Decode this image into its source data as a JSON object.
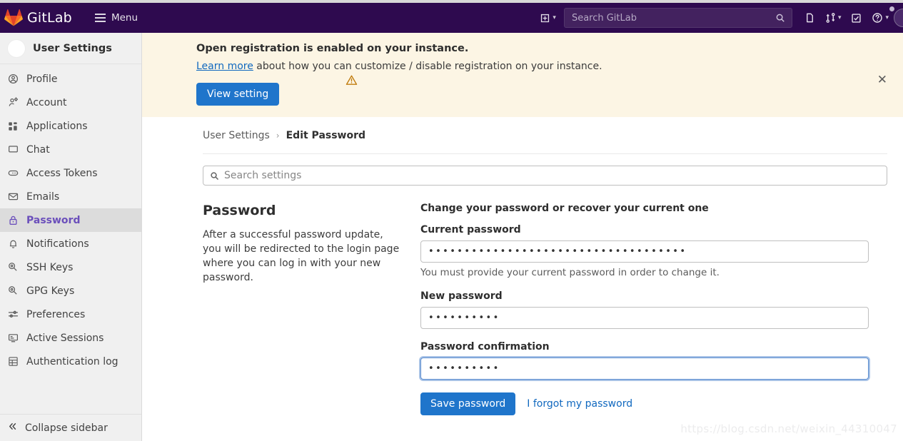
{
  "navbar": {
    "brand": "GitLab",
    "menu_label": "Menu",
    "search_placeholder": "Search GitLab",
    "search_value": "",
    "icons": {
      "create_new": "plus-square-icon",
      "create_new_chevron": "chevron-down-icon",
      "search": "search-icon",
      "issues": "issues-icon",
      "merge_requests": "merge-request-icon",
      "merge_requests_chevron": "chevron-down-icon",
      "todos": "todos-check-icon",
      "help": "question-circle-icon",
      "help_chevron": "chevron-down-icon",
      "avatar": "user-avatar"
    },
    "background": "#2e0a4f"
  },
  "sidebar": {
    "title": "User Settings",
    "avatar_icon": "user-avatar",
    "items": [
      {
        "label": "Profile",
        "icon": "profile-icon",
        "active": false
      },
      {
        "label": "Account",
        "icon": "account-gear-icon",
        "active": false
      },
      {
        "label": "Applications",
        "icon": "applications-icon",
        "active": false
      },
      {
        "label": "Chat",
        "icon": "chat-icon",
        "active": false
      },
      {
        "label": "Access Tokens",
        "icon": "token-icon",
        "active": false
      },
      {
        "label": "Emails",
        "icon": "envelope-icon",
        "active": false
      },
      {
        "label": "Password",
        "icon": "lock-icon",
        "active": true
      },
      {
        "label": "Notifications",
        "icon": "bell-icon",
        "active": false
      },
      {
        "label": "SSH Keys",
        "icon": "key-icon",
        "active": false
      },
      {
        "label": "GPG Keys",
        "icon": "key-icon",
        "active": false
      },
      {
        "label": "Preferences",
        "icon": "sliders-icon",
        "active": false
      },
      {
        "label": "Active Sessions",
        "icon": "monitor-icon",
        "active": false
      },
      {
        "label": "Authentication log",
        "icon": "log-table-icon",
        "active": false
      }
    ],
    "collapse_label": "Collapse sidebar",
    "collapse_icon": "chevron-double-left-icon",
    "active_color": "#6b4fbb"
  },
  "alert": {
    "icon": "warning-triangle-icon",
    "title": "Open registration is enabled on your instance.",
    "link_text": "Learn more",
    "body_text": " about how you can customize / disable registration on your instance.",
    "button_label": "View setting",
    "close_icon": "close-icon",
    "background": "#fcf5e4",
    "accent": "#c17d10"
  },
  "breadcrumb": {
    "root": "User Settings",
    "separator": "›",
    "current": "Edit Password"
  },
  "settings_search": {
    "icon": "search-icon",
    "placeholder": "Search settings",
    "value": ""
  },
  "main": {
    "section_title": "Password",
    "section_description": "After a successful password update, you will be redirected to the login page where you can log in with your new password.",
    "form_lead": "Change your password or recover your current one",
    "fields": [
      {
        "label": "Current password",
        "value": "••••••••••••••••••••••••••••••••••••",
        "hint": "You must provide your current password in order to change it.",
        "focused": false
      },
      {
        "label": "New password",
        "value": "••••••••••",
        "hint": "",
        "focused": false
      },
      {
        "label": "Password confirmation",
        "value": "••••••••••",
        "hint": "",
        "focused": true
      }
    ],
    "save_label": "Save password",
    "forgot_label": "I forgot my password",
    "primary_color": "#1f75cb"
  },
  "watermark": "https://blog.csdn.net/weixin_44310047"
}
